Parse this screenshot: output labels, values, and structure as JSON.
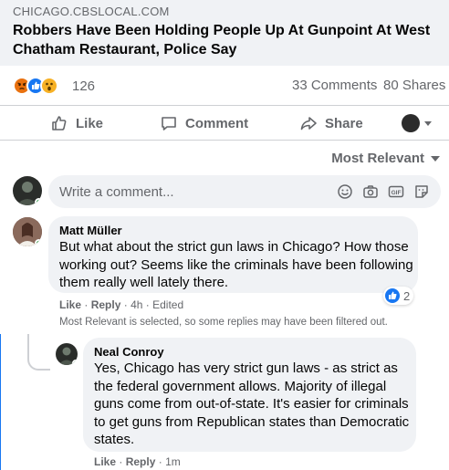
{
  "link_preview": {
    "domain": "CHICAGO.CBSLOCAL.COM",
    "title": "Robbers Have Been Holding People Up At Gunpoint At West Chatham Restaurant, Police Say"
  },
  "reactions": {
    "icons": [
      "angry-icon",
      "like-icon",
      "wow-icon"
    ],
    "count": "126",
    "comments": "33 Comments",
    "shares": "80 Shares"
  },
  "actions": {
    "like": "Like",
    "comment": "Comment",
    "share": "Share"
  },
  "sort": {
    "label": "Most Relevant"
  },
  "composer": {
    "placeholder": "Write a comment...",
    "tools": [
      "emoji-icon",
      "camera-icon",
      "gif-icon",
      "sticker-icon"
    ]
  },
  "comments": [
    {
      "author": "Matt Müller",
      "text": "But what about the strict gun laws in Chicago? How those working out? Seems like the criminals have been following them really well lately there.",
      "like_action": "Like",
      "reply_action": "Reply",
      "time": "4h",
      "edited": "Edited",
      "reaction_count": "2",
      "filter_note": "Most Relevant is selected, so some replies may have been filtered out."
    },
    {
      "author": "Neal Conroy",
      "text": "Yes, Chicago has very strict gun laws - as strict as the federal government allows. Majority of illegal guns come from out-of-state. It's easier for criminals to get guns from Republican states than Democratic states.",
      "like_action": "Like",
      "reply_action": "Reply",
      "time": "1m"
    }
  ],
  "colors": {
    "brand_blue": "#1877f2",
    "secondary_text": "#65676b",
    "bubble_bg": "#f0f2f5",
    "online_green": "#31a24c"
  }
}
